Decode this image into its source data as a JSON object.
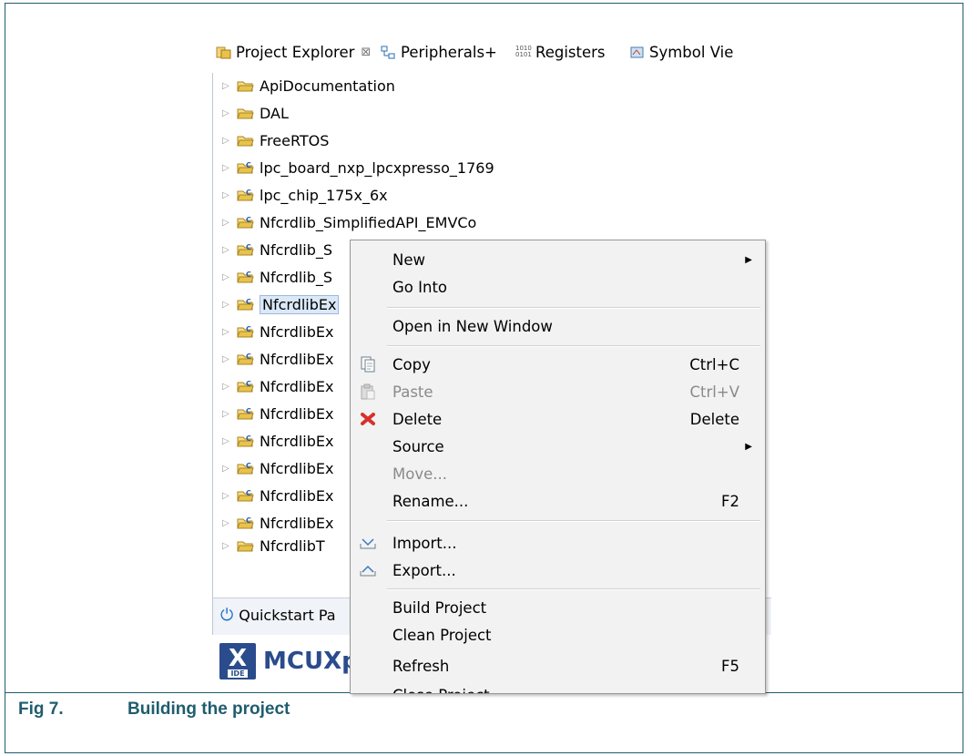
{
  "caption": {
    "number": "Fig 7.",
    "title": "Building the project"
  },
  "tabs": [
    {
      "label": "Project Explorer",
      "icon": "project-explorer-icon"
    },
    {
      "label": "Peripherals+",
      "icon": "peripherals-icon"
    },
    {
      "label": "Registers",
      "icon": "registers-icon"
    },
    {
      "label": "Symbol Vie",
      "icon": "symbol-viewer-icon"
    }
  ],
  "tree": [
    {
      "label": "ApiDocumentation",
      "kind": "folder"
    },
    {
      "label": "DAL",
      "kind": "folder"
    },
    {
      "label": "FreeRTOS",
      "kind": "folder"
    },
    {
      "label": "lpc_board_nxp_lpcxpresso_1769",
      "kind": "project"
    },
    {
      "label": "lpc_chip_175x_6x",
      "kind": "project"
    },
    {
      "label": "Nfcrdlib_SimplifiedAPI_EMVCo",
      "kind": "project"
    },
    {
      "label": "Nfcrdlib_S",
      "kind": "project"
    },
    {
      "label": "Nfcrdlib_S",
      "kind": "project"
    },
    {
      "label": "NfcrdlibEx",
      "kind": "project",
      "selected": true
    },
    {
      "label": "NfcrdlibEx",
      "kind": "project"
    },
    {
      "label": "NfcrdlibEx",
      "kind": "project"
    },
    {
      "label": "NfcrdlibEx",
      "kind": "project"
    },
    {
      "label": "NfcrdlibEx",
      "kind": "project"
    },
    {
      "label": "NfcrdlibEx",
      "kind": "project"
    },
    {
      "label": "NfcrdlibEx",
      "kind": "project"
    },
    {
      "label": "NfcrdlibEx",
      "kind": "project"
    },
    {
      "label": "NfcrdlibEx",
      "kind": "project"
    },
    {
      "label": "NfcrdlibT",
      "kind": "project"
    }
  ],
  "quickstart": "Quickstart Pa",
  "brand": {
    "logo_letter": "X",
    "logo_sub": "IDE",
    "text": "MCUXp"
  },
  "menu": {
    "new": "New",
    "go_into": "Go Into",
    "open_new_window": "Open in New Window",
    "copy": "Copy",
    "copy_sc": "Ctrl+C",
    "paste": "Paste",
    "paste_sc": "Ctrl+V",
    "delete": "Delete",
    "delete_sc": "Delete",
    "source": "Source",
    "move": "Move...",
    "rename": "Rename...",
    "rename_sc": "F2",
    "import": "Import...",
    "export": "Export...",
    "build": "Build Project",
    "clean": "Clean Project",
    "refresh": "Refresh",
    "refresh_sc": "F5",
    "close": "Close Project"
  },
  "colors": {
    "caption": "#1f5d6e",
    "folder": "#e8c24a",
    "delete_icon": "#d9302c"
  }
}
